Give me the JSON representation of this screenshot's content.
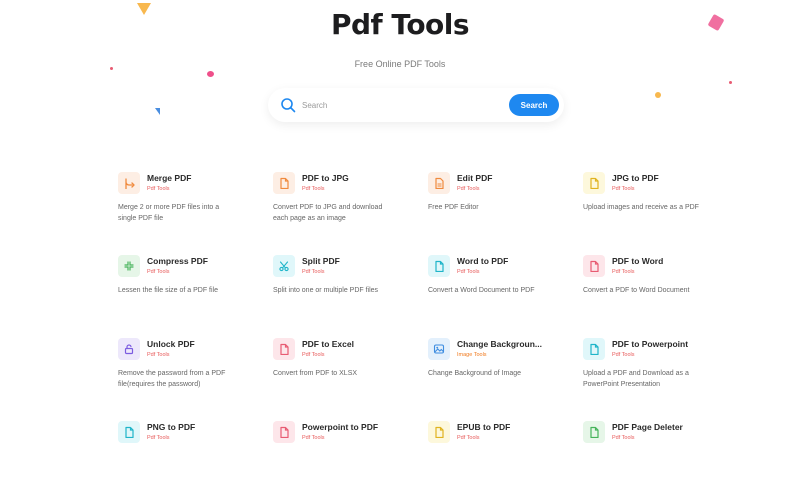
{
  "page": {
    "title": "Pdf Tools",
    "subtitle": "Free Online PDF Tools"
  },
  "search": {
    "placeholder": "Search",
    "button_label": "Search",
    "icon": "search-icon"
  },
  "colors": {
    "primary": "#1e88f0",
    "category_pdf": "#e85b5b",
    "category_image": "#f07a1e"
  },
  "tools": [
    {
      "name": "Merge PDF",
      "category": "Pdf Tools",
      "description": "Merge 2 or more PDF files into a single PDF file",
      "icon": "merge-icon",
      "icon_bg": "#fdeee4",
      "icon_color": "#f08a3e"
    },
    {
      "name": "PDF to JPG",
      "category": "Pdf Tools",
      "description": "Convert PDF to JPG and download each page as an image",
      "icon": "file-icon",
      "icon_bg": "#fdeee4",
      "icon_color": "#f08a3e"
    },
    {
      "name": "Edit PDF",
      "category": "Pdf Tools",
      "description": "Free PDF Editor",
      "icon": "file-edit-icon",
      "icon_bg": "#fdeee4",
      "icon_color": "#f08a3e"
    },
    {
      "name": "JPG to PDF",
      "category": "Pdf Tools",
      "description": "Upload images and receive as a PDF",
      "icon": "file-icon",
      "icon_bg": "#fdf8dc",
      "icon_color": "#e0b320"
    },
    {
      "name": "Compress PDF",
      "category": "Pdf Tools",
      "description": "Lessen the file size of a PDF file",
      "icon": "compress-icon",
      "icon_bg": "#e6f6e8",
      "icon_color": "#45b35a"
    },
    {
      "name": "Split PDF",
      "category": "Pdf Tools",
      "description": "Split into one or multiple PDF files",
      "icon": "scissors-icon",
      "icon_bg": "#e0f7fa",
      "icon_color": "#1fb5c9"
    },
    {
      "name": "Word to PDF",
      "category": "Pdf Tools",
      "description": "Convert a Word Document to PDF",
      "icon": "file-icon",
      "icon_bg": "#e0f7fa",
      "icon_color": "#1fb5c9"
    },
    {
      "name": "PDF to Word",
      "category": "Pdf Tools",
      "description": "Convert a PDF to Word Document",
      "icon": "file-icon",
      "icon_bg": "#fde6ea",
      "icon_color": "#e85b72"
    },
    {
      "name": "Unlock PDF",
      "category": "Pdf Tools",
      "description": "Remove the password from a PDF file(requires the password)",
      "icon": "lock-icon",
      "icon_bg": "#ede8fb",
      "icon_color": "#7c5ce0"
    },
    {
      "name": "PDF to Excel",
      "category": "Pdf Tools",
      "description": "Convert from PDF to XLSX",
      "icon": "file-icon",
      "icon_bg": "#fde6ea",
      "icon_color": "#e85b72"
    },
    {
      "name": "Change Backgroun...",
      "category": "Image Tools",
      "description": "Change Background of Image",
      "icon": "image-icon",
      "icon_bg": "#e3f0fc",
      "icon_color": "#3e8de0"
    },
    {
      "name": "PDF to Powerpoint",
      "category": "Pdf Tools",
      "description": "Upload a PDF and Download as a PowerPoint Presentation",
      "icon": "file-icon",
      "icon_bg": "#e0f7fa",
      "icon_color": "#1fb5c9"
    },
    {
      "name": "PNG to PDF",
      "category": "Pdf Tools",
      "description": "",
      "icon": "file-icon",
      "icon_bg": "#e0f7fa",
      "icon_color": "#1fb5c9"
    },
    {
      "name": "Powerpoint to PDF",
      "category": "Pdf Tools",
      "description": "",
      "icon": "file-icon",
      "icon_bg": "#fde6ea",
      "icon_color": "#e85b72"
    },
    {
      "name": "EPUB to PDF",
      "category": "Pdf Tools",
      "description": "",
      "icon": "file-icon",
      "icon_bg": "#fdf8dc",
      "icon_color": "#e0b320"
    },
    {
      "name": "PDF Page Deleter",
      "category": "Pdf Tools",
      "description": "",
      "icon": "file-icon",
      "icon_bg": "#e6f6e8",
      "icon_color": "#45b35a"
    }
  ]
}
